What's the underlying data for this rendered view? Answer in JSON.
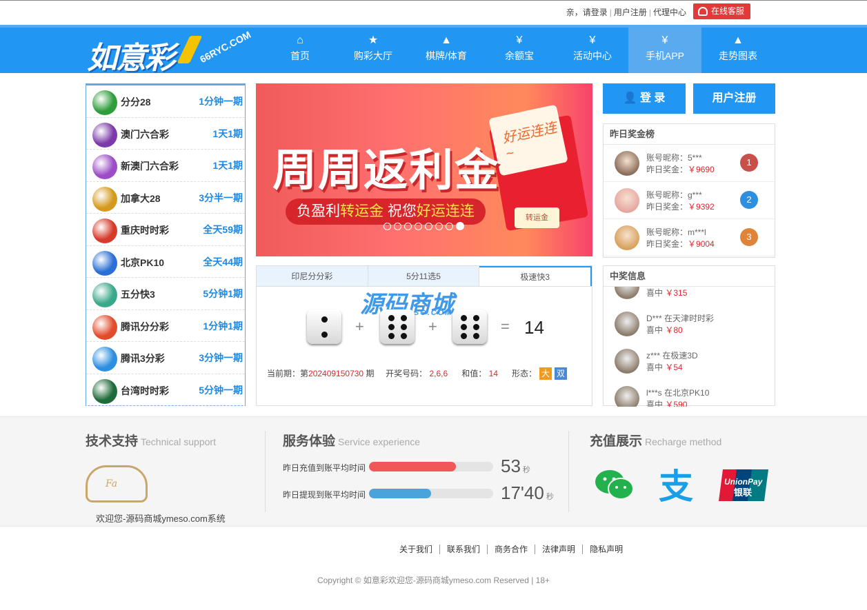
{
  "topbar": {
    "greeting": "亲，请登录",
    "register": "用户注册",
    "agent": "代理中心",
    "service": "在线客服"
  },
  "logo": {
    "text": "如意彩",
    "sub": "66RYC.COM"
  },
  "nav": [
    {
      "label": "首页",
      "icon": "home-icon",
      "glyph": "⌂"
    },
    {
      "label": "购彩大厅",
      "icon": "star-icon",
      "glyph": "★"
    },
    {
      "label": "棋牌/体育",
      "icon": "triangle-icon",
      "glyph": "▲"
    },
    {
      "label": "余额宝",
      "icon": "money-bag-icon",
      "glyph": "¥"
    },
    {
      "label": "活动中心",
      "icon": "money-bag-icon",
      "glyph": "¥"
    },
    {
      "label": "手机APP",
      "icon": "money-bag-icon",
      "glyph": "¥"
    },
    {
      "label": "走势图表",
      "icon": "triangle-icon",
      "glyph": "▲"
    }
  ],
  "lotteries": [
    {
      "name": "分分28",
      "period": "1分钟一期",
      "color": "#2e9d3a"
    },
    {
      "name": "澳门六合彩",
      "period": "1天1期",
      "color": "#7b3aa8"
    },
    {
      "name": "新澳门六合彩",
      "period": "1天1期",
      "color": "#9b4cc6"
    },
    {
      "name": "加拿大28",
      "period": "3分半一期",
      "color": "#d49a1e"
    },
    {
      "name": "重庆时时彩",
      "period": "全天59期",
      "color": "#d63a2a"
    },
    {
      "name": "北京PK10",
      "period": "全天44期",
      "color": "#2a6fd6"
    },
    {
      "name": "五分快3",
      "period": "5分钟1期",
      "color": "#3aa88a"
    },
    {
      "name": "腾讯分分彩",
      "period": "1分钟1期",
      "color": "#e24b2b"
    },
    {
      "name": "腾讯3分彩",
      "period": "3分钟一期",
      "color": "#2d8fe0"
    },
    {
      "name": "台湾时时彩",
      "period": "5分钟一期",
      "color": "#1f6b3a"
    }
  ],
  "banner": {
    "title": "周周返利金",
    "sub_prefix": "负盈利",
    "sub_hl1": "转运金",
    "sub_mid": " 祝您",
    "sub_hl2": "好运连连",
    "card": "好运连连~",
    "button": "转运金"
  },
  "game": {
    "tabs": [
      "印尼分分彩",
      "5分11选5",
      "极速快3"
    ],
    "dice": [
      2,
      6,
      6
    ],
    "plus": "+",
    "equals": "=",
    "sum": "14",
    "period_label": "当前期：第",
    "period": "202409150730",
    "period_suffix": "期",
    "numbers_label": "开奖号码：",
    "numbers": "2,6,6",
    "sum_label": "和值：",
    "sum_value": "14",
    "shape_label": "形态：",
    "tag_big": "大",
    "tag_even": "双"
  },
  "watermark": {
    "text": "源码商城",
    "sub": "YMESO.COM"
  },
  "buttons": {
    "login": "登 录",
    "register": "用户注册"
  },
  "ranking": {
    "title": "昨日奖金榜",
    "items": [
      {
        "nick": "账号昵称：5***",
        "prize_label": "昨日奖金：",
        "prize": "￥9690",
        "rank": "1",
        "color": "#c9504a"
      },
      {
        "nick": "账号昵称：g***",
        "prize_label": "昨日奖金：",
        "prize": "￥9392",
        "rank": "2",
        "color": "#2d8fe0"
      },
      {
        "nick": "账号昵称：m***l",
        "prize_label": "昨日奖金：",
        "prize": "￥9004",
        "rank": "3",
        "color": "#e0843a"
      }
    ]
  },
  "winners": {
    "title": "中奖信息",
    "items": [
      {
        "line1": "",
        "label": "喜中",
        "prize": "￥315"
      },
      {
        "line1": "D*** 在天津时时彩",
        "label": "喜中",
        "prize": "￥80"
      },
      {
        "line1": "z*** 在极速3D",
        "label": "喜中",
        "prize": "￥54"
      },
      {
        "line1": "l***s 在北京PK10",
        "label": "喜中",
        "prize": "￥590"
      }
    ]
  },
  "footer": {
    "support": {
      "title": "技术支持",
      "en": "Technical support",
      "welcome": "欢迎您-源码商城ymeso.com系统"
    },
    "service": {
      "title": "服务体验",
      "en": "Service experience",
      "rows": [
        {
          "label": "昨日充值到账平均时间",
          "value": "53",
          "unit": "秒",
          "fill": 0.7,
          "color": "#f25757"
        },
        {
          "label": "昨日提现到账平均时间",
          "value": "17'40",
          "unit": "秒",
          "fill": 0.5,
          "color": "#4aa3da"
        }
      ]
    },
    "recharge": {
      "title": "充值展示",
      "en": "Recharge method",
      "methods": [
        "wechat-pay-icon",
        "alipay-icon",
        "unionpay-icon"
      ]
    },
    "links": [
      "关于我们",
      "联系我们",
      "商务合作",
      "法律声明",
      "隐私声明"
    ],
    "copyright": "Copyright © 如意彩欢迎您-源码商城ymeso.com Reserved | 18+"
  }
}
